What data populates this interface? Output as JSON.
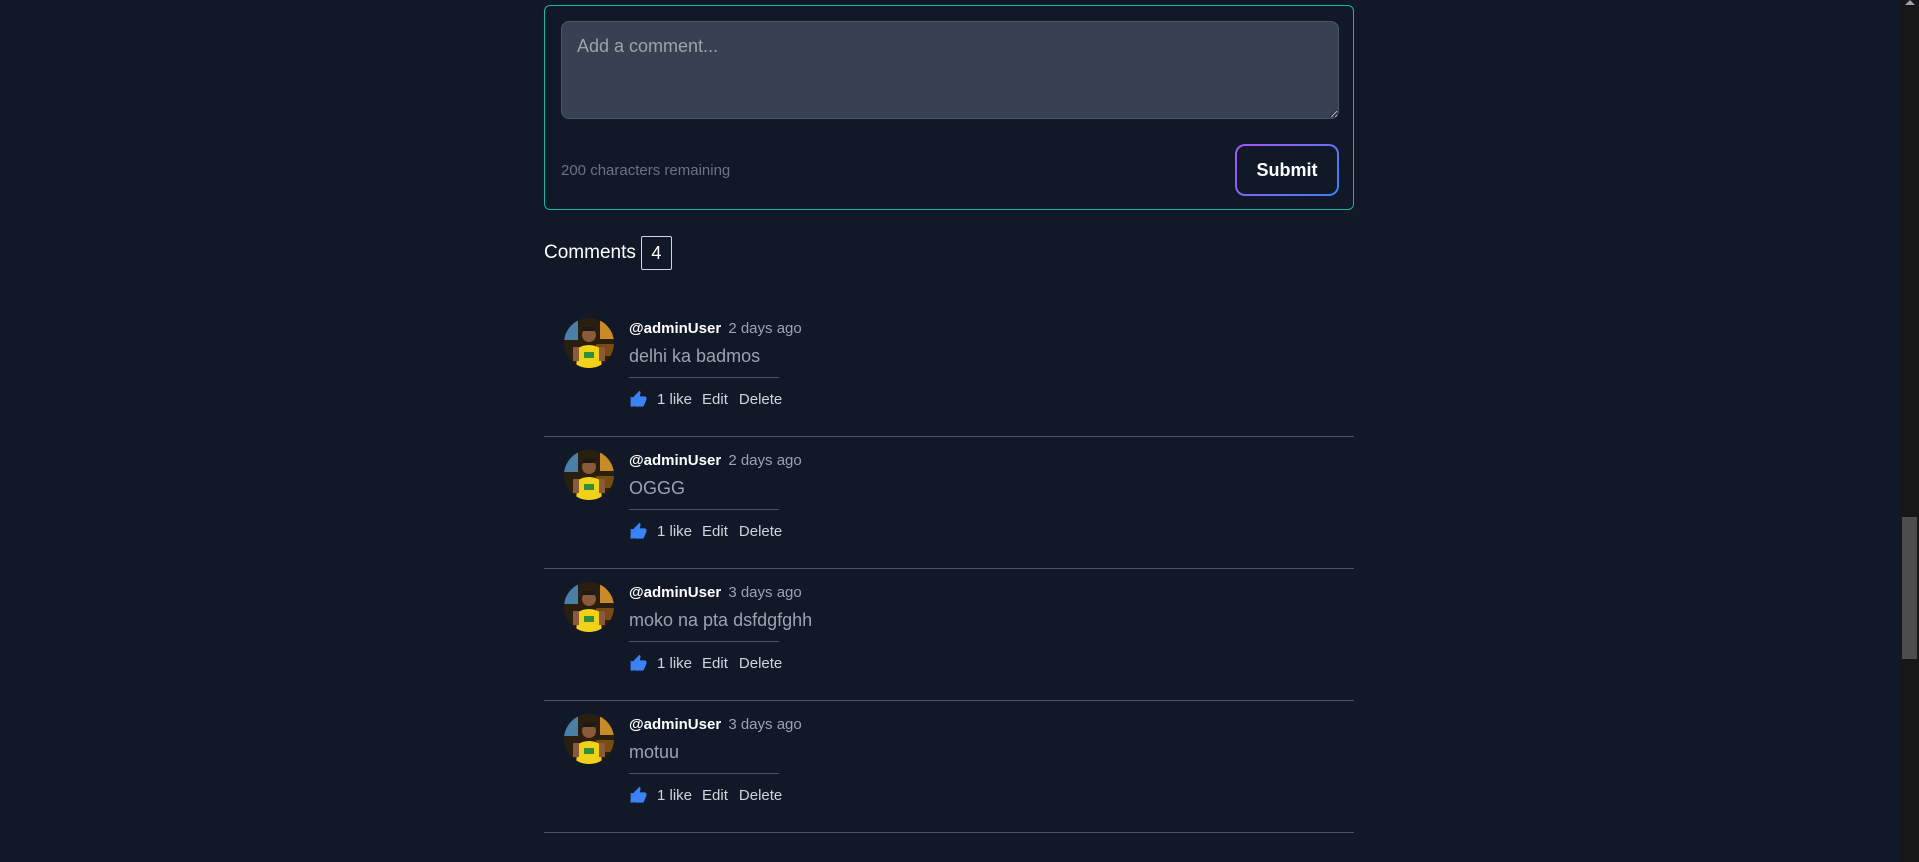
{
  "comment_form": {
    "textarea_placeholder": "Add a comment...",
    "textarea_value": "",
    "chars_remaining": "200 characters remaining",
    "submit_label": "Submit"
  },
  "comments_header": {
    "title": "Comments",
    "count": "4"
  },
  "comments": [
    {
      "username": "@adminUser",
      "timestamp": "2 days ago",
      "text": "delhi ka badmos",
      "likes": "1 like",
      "edit_label": "Edit",
      "delete_label": "Delete"
    },
    {
      "username": "@adminUser",
      "timestamp": "2 days ago",
      "text": "OGGG",
      "likes": "1 like",
      "edit_label": "Edit",
      "delete_label": "Delete"
    },
    {
      "username": "@adminUser",
      "timestamp": "3 days ago",
      "text": "moko na pta dsfdgfghh",
      "likes": "1 like",
      "edit_label": "Edit",
      "delete_label": "Delete"
    },
    {
      "username": "@adminUser",
      "timestamp": "3 days ago",
      "text": "motuu",
      "likes": "1 like",
      "edit_label": "Edit",
      "delete_label": "Delete"
    }
  ],
  "icons": {
    "like": "thumbs-up-icon",
    "avatar": "user-avatar"
  },
  "colors": {
    "background": "#111827",
    "form_border": "#14b8a6",
    "like_icon": "#3b82f6",
    "submit_gradient_start": "#a855f7",
    "submit_gradient_end": "#3b82f6"
  }
}
